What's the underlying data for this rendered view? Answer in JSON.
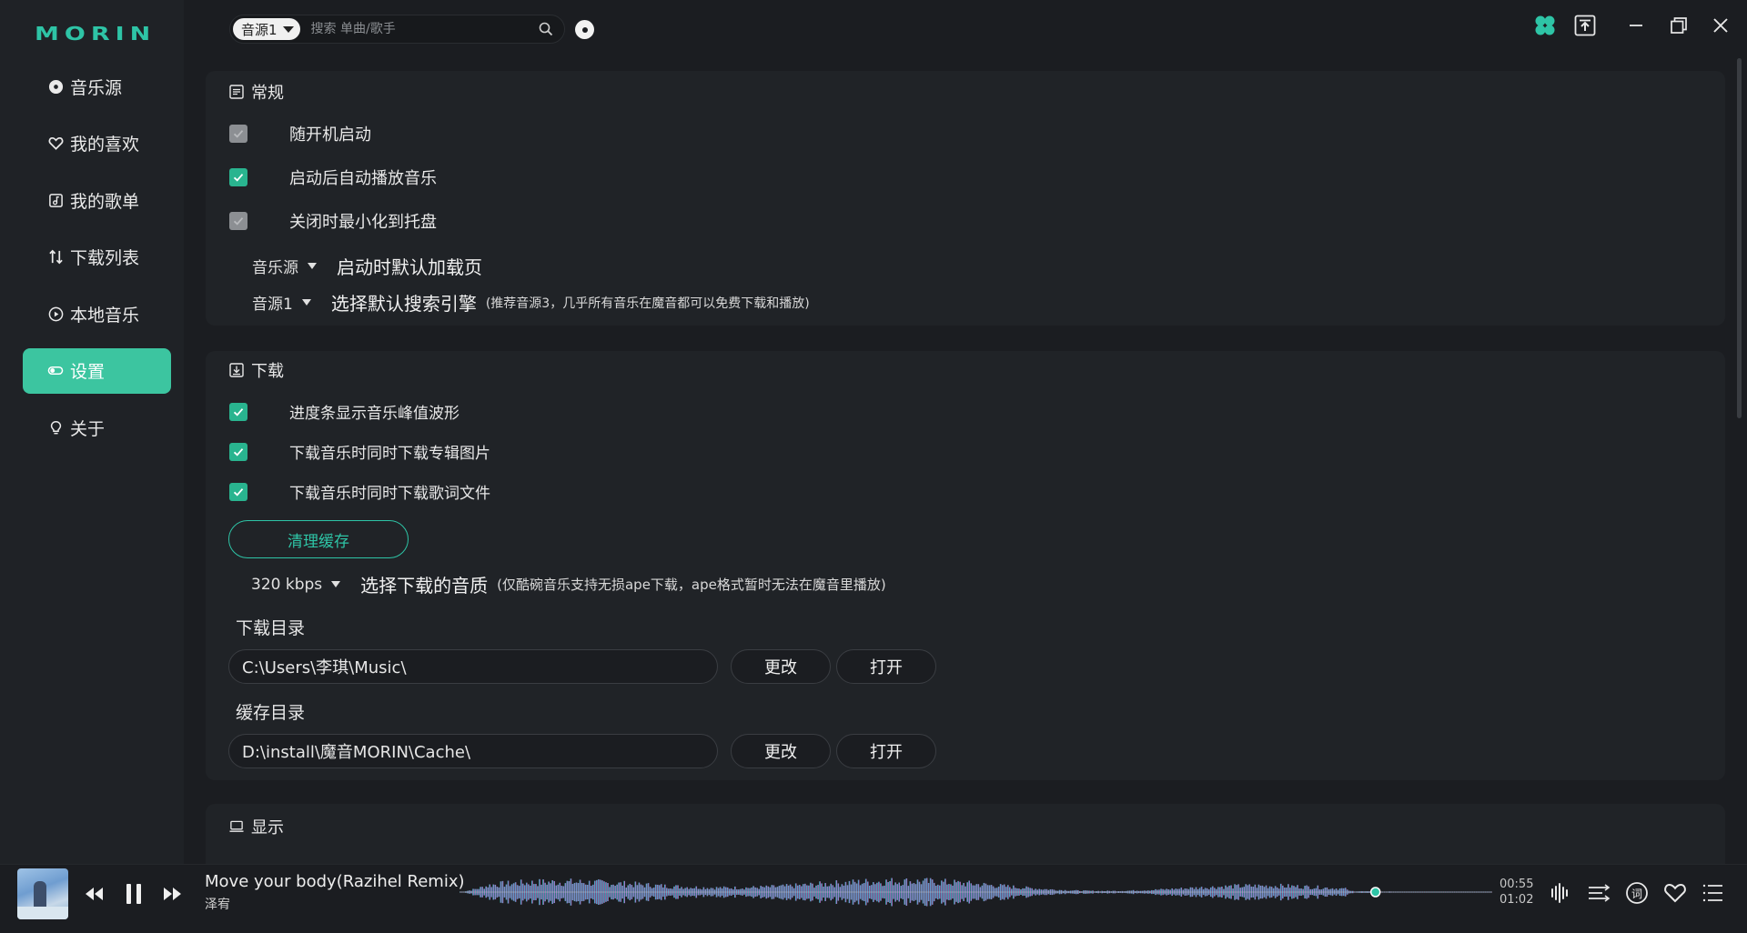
{
  "app": {
    "logo_text": "MORIN",
    "accent": "#2ec4a6",
    "active_bg": "#3cc5a0"
  },
  "sidebar": {
    "items": [
      {
        "label": "音乐源",
        "icon": "disc-icon"
      },
      {
        "label": "我的喜欢",
        "icon": "heart-icon"
      },
      {
        "label": "我的歌单",
        "icon": "playlist-icon"
      },
      {
        "label": "下载列表",
        "icon": "sort-icon"
      },
      {
        "label": "本地音乐",
        "icon": "play-circle-icon"
      },
      {
        "label": "设置",
        "icon": "toggle-icon",
        "active": true
      },
      {
        "label": "关于",
        "icon": "bulb-icon"
      }
    ]
  },
  "topbar": {
    "source_select": "音源1",
    "search_placeholder": "搜索 单曲/歌手"
  },
  "general": {
    "title": "常规",
    "options": [
      {
        "label": "随开机启动",
        "checked": false
      },
      {
        "label": "启动后自动播放音乐",
        "checked": true
      },
      {
        "label": "关闭时最小化到托盘",
        "checked": false
      }
    ],
    "default_page_value": "音乐源",
    "default_page_label": "启动时默认加载页",
    "search_engine_value": "音源1",
    "search_engine_label": "选择默认搜索引擎",
    "search_engine_hint": "(推荐音源3，几乎所有音乐在魔音都可以免费下载和播放)"
  },
  "download": {
    "title": "下载",
    "options": [
      {
        "label": "进度条显示音乐峰值波形",
        "checked": true
      },
      {
        "label": "下载音乐时同时下载专辑图片",
        "checked": true
      },
      {
        "label": "下载音乐时同时下载歌词文件",
        "checked": true
      }
    ],
    "clear_cache": "清理缓存",
    "quality_value": "320 kbps",
    "quality_label": "选择下载的音质",
    "quality_hint": "(仅酷碗音乐支持无损ape下载，ape格式暂时无法在魔音里播放)",
    "dir_label": "下载目录",
    "dir_value": "C:\\Users\\李琪\\Music\\",
    "cache_label": "缓存目录",
    "cache_value": "D:\\install\\魔音MORIN\\Cache\\",
    "change": "更改",
    "open": "打开"
  },
  "display": {
    "title": "显示"
  },
  "player": {
    "title": "Move your body(Razihel Remix)",
    "artist": "泽宥",
    "elapsed": "00:55",
    "total": "01:02",
    "progress": 0.887,
    "lyrics_icon_text": "词"
  }
}
